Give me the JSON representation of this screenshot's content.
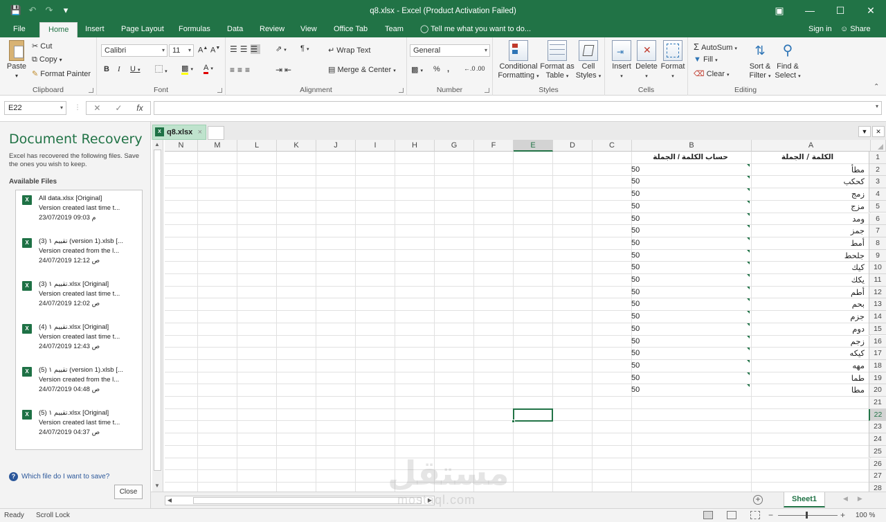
{
  "window": {
    "title": "q8.xlsx - Excel (Product Activation Failed)"
  },
  "ribbon_tabs": [
    "File",
    "Home",
    "Insert",
    "Page Layout",
    "Formulas",
    "Data",
    "Review",
    "View",
    "Office Tab",
    "Team"
  ],
  "tell_me": "Tell me what you want to do...",
  "sign_in": "Sign in",
  "share": "Share",
  "clipboard": {
    "paste": "Paste",
    "cut": "Cut",
    "copy": "Copy",
    "format_painter": "Format Painter",
    "label": "Clipboard"
  },
  "font": {
    "name": "Calibri",
    "size": "11",
    "label": "Font"
  },
  "alignment": {
    "wrap_text": "Wrap Text",
    "merge_center": "Merge & Center",
    "label": "Alignment"
  },
  "number": {
    "format": "General",
    "label": "Number"
  },
  "styles": {
    "conditional": "Conditional",
    "formatting": "Formatting",
    "format_as": "Format as",
    "table": "Table",
    "cell": "Cell",
    "cell_styles": "Styles",
    "label": "Styles"
  },
  "cells": {
    "insert": "Insert",
    "delete": "Delete",
    "format": "Format",
    "label": "Cells"
  },
  "editing": {
    "autosum": "AutoSum",
    "fill": "Fill",
    "clear": "Clear",
    "sort_filter_1": "Sort &",
    "sort_filter_2": "Filter",
    "find_select_1": "Find &",
    "find_select_2": "Select",
    "label": "Editing"
  },
  "formula_bar": {
    "name_box": "E22",
    "fx": "fx",
    "value": ""
  },
  "recovery": {
    "title": "Document Recovery",
    "description": "Excel has recovered the following files. Save the ones you wish to keep.",
    "available": "Available Files",
    "files": [
      {
        "name": "All data.xlsx  [Original]",
        "line2": "Version created last time t...",
        "line3": "23/07/2019 09:03 م"
      },
      {
        "name": "تقييم ١ (3) (version 1).xlsb  [...",
        "line2": "Version created from the l...",
        "line3": "24/07/2019 12:12 ص"
      },
      {
        "name": "تقييم ١ (3).xlsx  [Original]",
        "line2": "Version created last time t...",
        "line3": "24/07/2019 12:02 ص"
      },
      {
        "name": "تقييم ١ (4).xlsx  [Original]",
        "line2": "Version created last time t...",
        "line3": "24/07/2019 12:43 ص"
      },
      {
        "name": "تقييم ١ (5) (version 1).xlsb  [...",
        "line2": "Version created from the l...",
        "line3": "24/07/2019 04:48 ص"
      },
      {
        "name": "تقييم ١ (5).xlsx  [Original]",
        "line2": "Version created last time t...",
        "line3": "24/07/2019 04:37 ص"
      }
    ],
    "help": "Which file do I want to save?",
    "close": "Close"
  },
  "doc_tab": "q8.xlsx",
  "columns": [
    "N",
    "M",
    "L",
    "K",
    "J",
    "I",
    "H",
    "G",
    "F",
    "E",
    "D",
    "C",
    "B",
    "A"
  ],
  "rows": [
    "1",
    "2",
    "3",
    "4",
    "5",
    "6",
    "7",
    "8",
    "9",
    "10",
    "11",
    "12",
    "13",
    "14",
    "15",
    "16",
    "17",
    "18",
    "19",
    "20",
    "21",
    "22",
    "23",
    "24",
    "25",
    "26",
    "27",
    "28"
  ],
  "sheet": {
    "header_a": "الكلمة / الجملة",
    "header_b": "حساب الكلمة / الجملة",
    "words": [
      "مطأ",
      "كحكب",
      "زمج",
      "مزج",
      "ومد",
      "جمز",
      "أمط",
      "جلحط",
      "كيك",
      "يكك",
      "أطم",
      "بحم",
      "جزم",
      "دوم",
      "زجم",
      "كيكه",
      "مهه",
      "طما",
      "مطا"
    ],
    "values": [
      "50",
      "50",
      "50",
      "50",
      "50",
      "50",
      "50",
      "50",
      "50",
      "50",
      "50",
      "50",
      "50",
      "50",
      "50",
      "50",
      "50",
      "50",
      "50"
    ]
  },
  "sheet_tab": "Sheet1",
  "status": {
    "ready": "Ready",
    "scroll_lock": "Scroll Lock",
    "zoom": "100 %"
  },
  "watermark": {
    "arabic": "مستقل",
    "latin": "mostaql.com"
  }
}
